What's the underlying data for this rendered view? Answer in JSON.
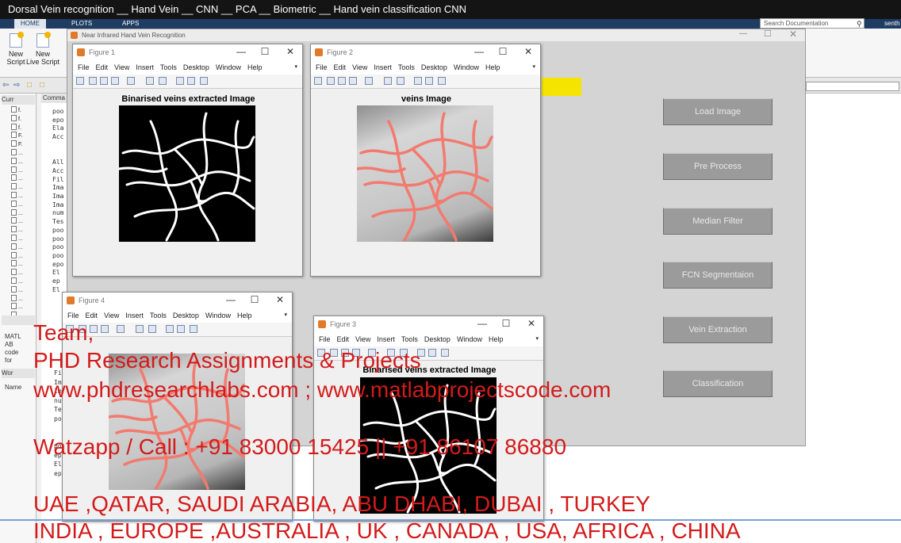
{
  "video": {
    "title": "Dorsal Vein recognition __ Hand Vein __ CNN __ PCA __ Biometric __ Hand vein classification CNN"
  },
  "matlab": {
    "tabs": [
      "HOME",
      "PLOTS",
      "APPS"
    ],
    "search_placeholder": "Search Documentation",
    "user": "senth",
    "ribbon": {
      "new_script": "New\nScript",
      "new_live_script": "New\nLive Script"
    },
    "current_folder_label": "Curr",
    "command_label": "Comma",
    "workspace_label": "Wor",
    "name_column": "Name",
    "folder_items": [
      "f.",
      "f.",
      "f.",
      "F.",
      "F.",
      "...",
      "...",
      "...",
      "...",
      "...",
      "...",
      "...",
      "...",
      "...",
      "...",
      "...",
      "...",
      "...",
      "...",
      "...",
      "...",
      "...",
      "...",
      "...",
      "..."
    ],
    "details": [
      "MATL",
      "AB",
      "code",
      "for"
    ],
    "cmd_lines": [
      "poo",
      "epo",
      "Ela",
      "Acc",
      "",
      "",
      "All",
      "Acc",
      "Fil",
      "Ima",
      "Ima",
      "Ima",
      "num",
      "Tes",
      "poo",
      "poo",
      "poo",
      "poo",
      "epo",
      "El",
      "ep",
      "El"
    ],
    "cmd_lines2": [
      "Fi",
      "Im",
      "Im",
      "nu",
      "Te",
      "po",
      "",
      "",
      "po",
      "ep",
      "El",
      "ep"
    ]
  },
  "gui": {
    "title": "Near Infrared Hand Vein Recognition",
    "buttons": [
      "Load Image",
      "Pre Process",
      "Median Filter",
      "FCN Segmentaion",
      "Vein Extraction",
      "Classification"
    ]
  },
  "figure_menu": [
    "File",
    "Edit",
    "View",
    "Insert",
    "Tools",
    "Desktop",
    "Window",
    "Help"
  ],
  "figures": {
    "f1": {
      "title": "Figure 1",
      "axes_title": "Binarised veins extracted Image"
    },
    "f2": {
      "title": "Figure 2",
      "axes_title": "veins Image"
    },
    "f3": {
      "title": "Figure 3",
      "axes_title": "Binarised veins extracted Image"
    },
    "f4": {
      "title": "Figure 4",
      "axes_title": ""
    }
  },
  "overlay": {
    "line1": "Team,",
    "line2": "PHD Research Assignments & Projects",
    "line3": "www.phdresearchlabs.com ; www.matlabprojectscode.com",
    "line4": "Watzapp / Call : +91 83000 15425 || +91 86107 86880",
    "line5": "UAE ,QATAR, SAUDI ARABIA, ABU DHABI, DUBAI , TURKEY",
    "line6": "INDIA , EUROPE ,AUSTRALIA , UK , CANADA , USA, AFRICA , CHINA"
  }
}
